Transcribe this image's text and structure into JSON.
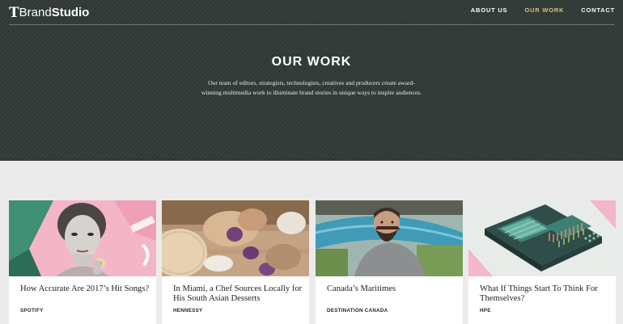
{
  "header": {
    "logo": {
      "t": "T",
      "brand": "Brand",
      "studio": "Studio"
    },
    "nav": [
      {
        "label": "ABOUT US"
      },
      {
        "label": "OUR WORK",
        "active": true
      },
      {
        "label": "CONTACT"
      }
    ]
  },
  "hero": {
    "title": "OUR WORK",
    "description": "Our team of editors, strategists, technologists, creatives and producers create award-winning multimedia work to illuminate brand stories in unique ways to inspire audiences."
  },
  "cards": [
    {
      "title": "How Accurate Are 2017’s Hit Songs?",
      "client": "SPOTIFY"
    },
    {
      "title": "In Miami, a Chef Sources Locally for His South Asian Desserts",
      "client": "HENNESSY"
    },
    {
      "title": "Canada’s Maritimes",
      "client": "DESTINATION CANADA"
    },
    {
      "title": "What If Things Start To Think For Themselves?",
      "client": "HPE"
    }
  ],
  "colors": {
    "hero_bg": "#323a38",
    "nav_active": "#d8c27a",
    "page_bg": "#ebebeb"
  }
}
